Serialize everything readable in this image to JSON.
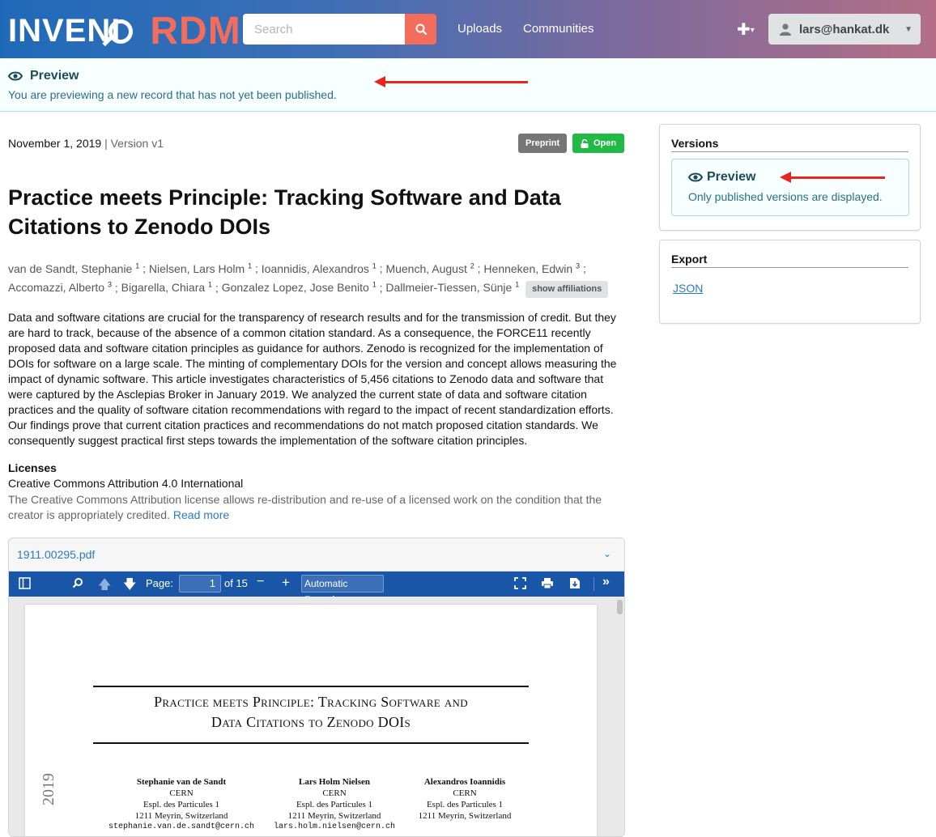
{
  "header": {
    "logo_part1": "INVENI",
    "logo_part2": "RDM",
    "search_placeholder": "Search",
    "nav": [
      "Uploads",
      "Communities"
    ],
    "user": "lars@hankat.dk",
    "icons": [
      "search-icon",
      "plus-icon",
      "user-icon"
    ]
  },
  "banner": {
    "title": "Preview",
    "text": "You are previewing a new record that has not yet been published."
  },
  "record": {
    "date": "November 1, 2019",
    "version_sep": " | ",
    "version": "Version v1",
    "label_type": "Preprint",
    "label_access": "Open",
    "title": "Practice meets Principle: Tracking Software and Data Citations to Zenodo DOIs",
    "creators": [
      {
        "name": "van de Sandt, Stephanie",
        "aff": "1"
      },
      {
        "name": "Nielsen, Lars Holm",
        "aff": "1"
      },
      {
        "name": "Ioannidis, Alexandros",
        "aff": "1"
      },
      {
        "name": "Muench, August",
        "aff": "2"
      },
      {
        "name": "Henneken, Edwin",
        "aff": "3"
      },
      {
        "name": "Accomazzi, Alberto",
        "aff": "3"
      },
      {
        "name": "Bigarella, Chiara",
        "aff": "1"
      },
      {
        "name": "Gonzalez Lopez, Jose Benito",
        "aff": "1"
      },
      {
        "name": "Dallmeier-Tiessen, Sünje",
        "aff": "1"
      }
    ],
    "show_affiliations": "show affiliations",
    "abstract": "Data and software citations are crucial for the transparency of research results and for the transmission of credit. But they are hard to track, because of the absence of a common citation standard. As a consequence, the FORCE11 recently proposed data and software citation principles as guidance for authors. Zenodo is recognized for the implementation of DOIs for software on a large scale. The minting of complementary DOIs for the version and concept allows measuring the impact of dynamic software. This article investigates characteristics of 5,456 citations to Zenodo data and software that were captured by the Asclepias Broker in January 2019. We analyzed the current state of data and software citation practices and the quality of software citation recommendations with regard to the impact of recent standardization efforts. Our findings prove that current citation practices and recommendations do not match proposed citation standards. We consequently suggest practical first steps towards the implementation of the software citation principles.",
    "licenses_heading": "Licenses",
    "license_name": "Creative Commons Attribution 4.0 International",
    "license_desc": "The Creative Commons Attribution license allows re-distribution and re-use of a licensed work on the condition that the creator is appropriately credited.",
    "read_more": "Read more"
  },
  "pdf": {
    "filename": "1911.00295.pdf",
    "page_label": "Page:",
    "page_value": "1",
    "page_total": "of 15",
    "zoom": "Automatic Zoom",
    "paper_title_line1": "Practice meets Principle: Tracking Software and",
    "paper_title_line2": "Data Citations to Zenodo DOIs",
    "side_year": "2019",
    "authors": [
      {
        "name": "Stephanie van de Sandt",
        "org": "CERN",
        "addr1": "Espl. des Particules 1",
        "addr2": "1211 Meyrin, Switzerland",
        "email": "stephanie.van.de.sandt@cern.ch"
      },
      {
        "name": "Lars Holm Nielsen",
        "org": "CERN",
        "addr1": "Espl. des Particules 1",
        "addr2": "1211 Meyrin, Switzerland",
        "email": "lars.holm.nielsen@cern.ch"
      },
      {
        "name": "Alexandros Ioannidis",
        "org": "CERN",
        "addr1": "Espl. des Particules 1",
        "addr2": "1211 Meyrin, Switzerland",
        "email": ""
      }
    ]
  },
  "sidebar": {
    "versions_title": "Versions",
    "versions_msg_title": "Preview",
    "versions_msg_text": "Only published versions are displayed.",
    "export_title": "Export",
    "export_json": "JSON"
  },
  "colors": {
    "accent": "#f26d5b",
    "link": "#2a7bc1",
    "open_label": "#21ba45",
    "arrow": "#e8261c"
  }
}
